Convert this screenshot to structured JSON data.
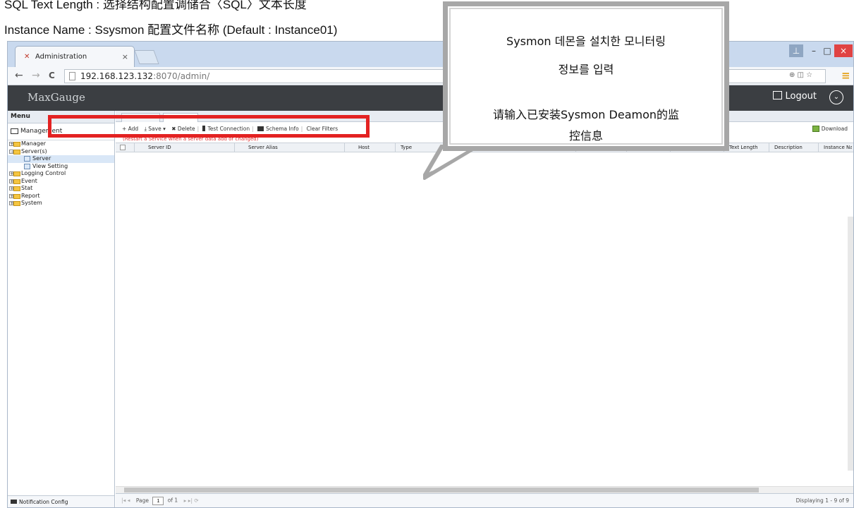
{
  "doc": {
    "line1": "SQL Text Length : 选择结构配置调储合〈SQL〉文本长度",
    "line2": "Instance Name : Ssysmon 配置文件名称 (Default : Instance01)"
  },
  "browser": {
    "tab_title": "Administration",
    "tab_close": "×",
    "url_host": "192.168.123.132",
    "url_path": ":8070/admin/",
    "back": "←",
    "forward": "→",
    "reload": "C",
    "min": "–",
    "max": "□",
    "close": "×",
    "user": "⊥",
    "right_icons": "⊕ ◫ ☆",
    "menu_icon": "≡"
  },
  "app": {
    "brand": "MaxGauge",
    "logout_label": "Logout",
    "user_icon": "⌄"
  },
  "menu": {
    "header": "Menu",
    "management": "Management",
    "items": [
      {
        "label": "Manager",
        "type": "folder",
        "pm": "+"
      },
      {
        "label": "Server(s)",
        "type": "folder",
        "pm": "−"
      },
      {
        "label": "Server",
        "type": "page"
      },
      {
        "label": "View Setting",
        "type": "page"
      },
      {
        "label": "Logging Control",
        "type": "folder",
        "pm": "+"
      },
      {
        "label": "Event",
        "type": "folder",
        "pm": "+"
      },
      {
        "label": "Stat",
        "type": "folder",
        "pm": "+"
      },
      {
        "label": "Report",
        "type": "folder",
        "pm": "+"
      },
      {
        "label": "System",
        "type": "folder",
        "pm": "+"
      }
    ],
    "notification": "Notification Config"
  },
  "toolbar": {
    "add": "+ Add",
    "save": "⤓ Save ▾",
    "delete": "✖ Delete",
    "test": "Test Connection",
    "schema": "Schema Info",
    "clear": "Clear Filters",
    "download": "Download"
  },
  "hint": "(Restart a Service when a server data add or changed)",
  "columns": [
    "Server ID",
    "Server Alias",
    "Host",
    "Type",
    "Text Length",
    "Description",
    "Instance Na"
  ],
  "pager": {
    "page_label": "Page",
    "page_value": "1",
    "of": "of 1",
    "displaying": "Displaying 1 - 9 of 9",
    "nav": "|◂ ◂",
    "nav2": "▸ ▸| ⟳"
  },
  "bubble": {
    "line1": "Sysmon 데몬을 설치한 모니터링",
    "line2": "정보를 입력",
    "line3": "请输入已安装Sysmon Deamon的监",
    "line4": "控信息"
  }
}
